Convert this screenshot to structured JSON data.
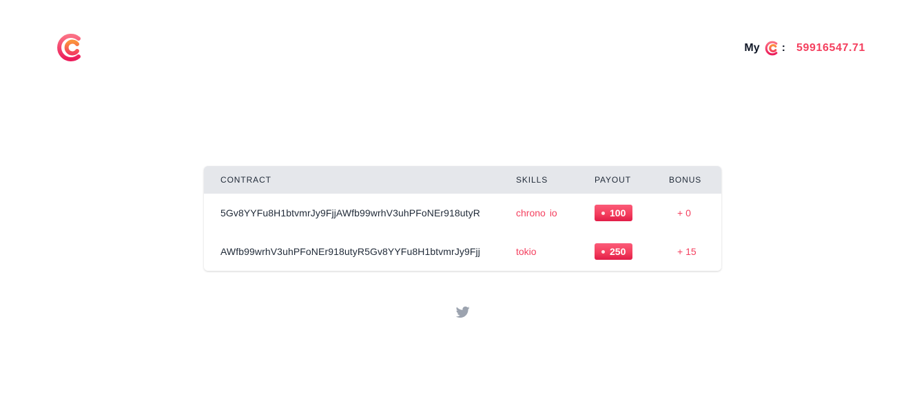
{
  "header": {
    "balance_label": "My",
    "balance_colon": ":",
    "balance_value": "59916547.71"
  },
  "table": {
    "columns": [
      "CONTRACT",
      "SKILLS",
      "PAYOUT",
      "BONUS"
    ],
    "rows": [
      {
        "contract": "5Gv8YYFu8H1btvmrJy9FjjAWfb99wrhV3uhPFoNEr918utyR",
        "skills": [
          "chrono",
          "io"
        ],
        "payout": "100",
        "bonus": "+ 0"
      },
      {
        "contract": "AWfb99wrhV3uhPFoNEr918utyR5Gv8YYFu8H1btvmrJy9Fjj",
        "skills": [
          "tokio"
        ],
        "payout": "250",
        "bonus": "+ 15"
      }
    ]
  },
  "icons": {
    "logo": "brand-logo-icon",
    "mini_logo": "brand-mini-logo-icon",
    "footer": "twitter-icon"
  },
  "colors": {
    "accent": "#f43f5e",
    "accent_dark": "#e11d48",
    "header_bg": "#e5e7eb",
    "icon_gray": "#9ca3af"
  }
}
